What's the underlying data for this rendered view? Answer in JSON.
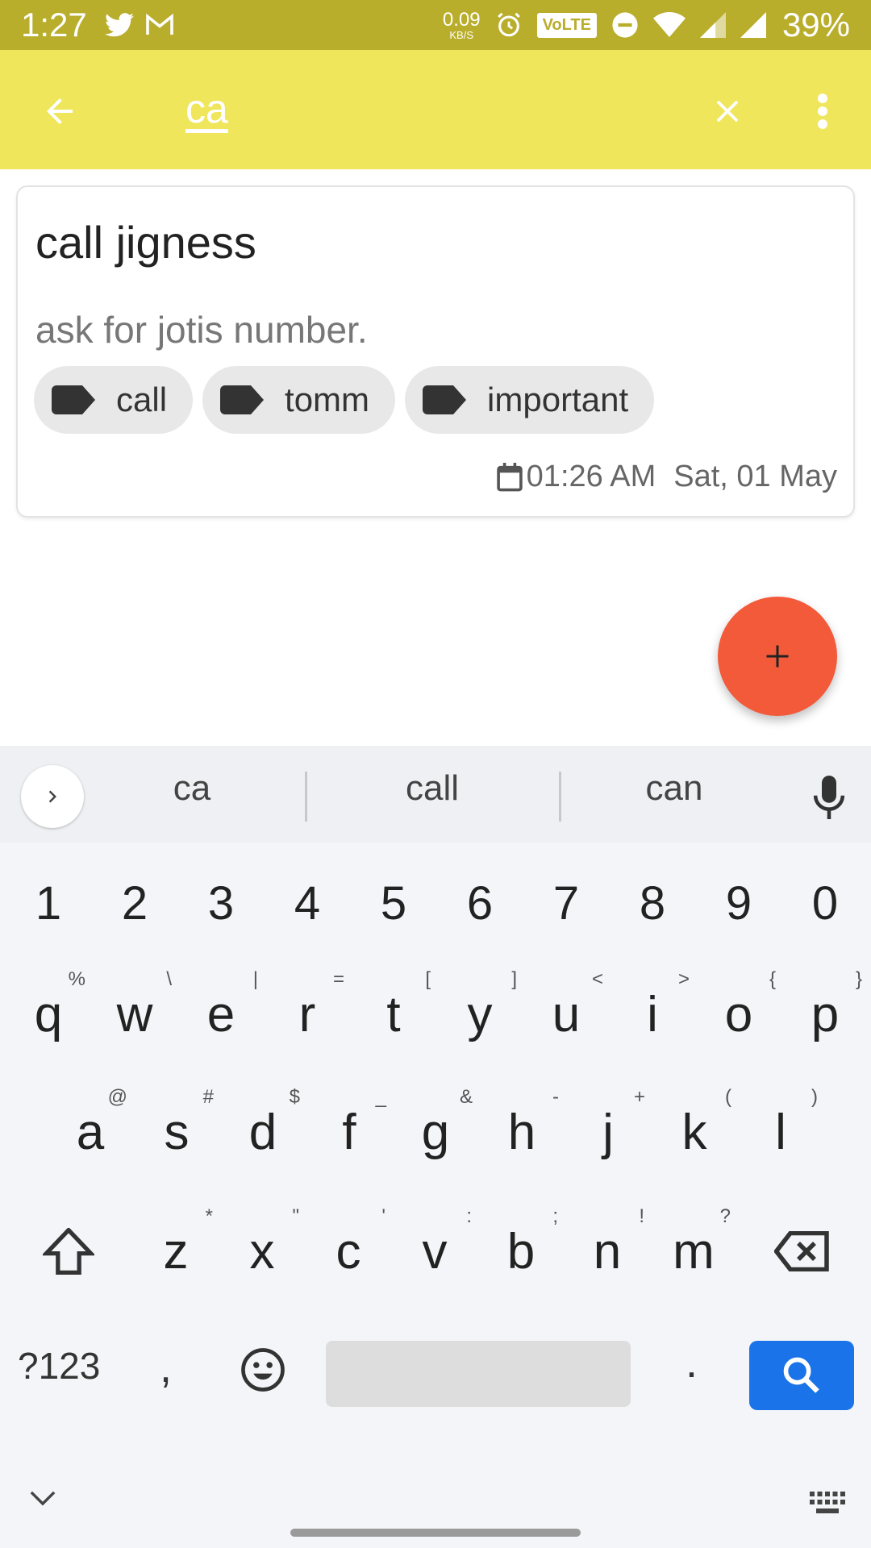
{
  "status_bar": {
    "time": "1:27",
    "net_speed": "0.09",
    "net_unit": "KB/S",
    "volte": "VoLTE",
    "battery": "39%",
    "icons": [
      "twitter-icon",
      "gmail-icon",
      "alarm-icon",
      "dnd-icon",
      "wifi-icon",
      "signal-icon",
      "signal-icon"
    ]
  },
  "app_bar": {
    "search_query": "ca",
    "color": "#efe65c"
  },
  "note": {
    "title": "call jigness",
    "body": "ask for jotis number.",
    "labels": [
      "call",
      "tomm",
      "important"
    ],
    "time": "01:26 AM",
    "date": "Sat, 01 May"
  },
  "fab": {
    "color": "#f25a3a",
    "icon": "plus-icon"
  },
  "keyboard": {
    "suggestions": [
      "ca",
      "call",
      "can"
    ],
    "number_row": [
      "1",
      "2",
      "3",
      "4",
      "5",
      "6",
      "7",
      "8",
      "9",
      "0"
    ],
    "row1": [
      {
        "k": "q",
        "h": "%"
      },
      {
        "k": "w",
        "h": "\\"
      },
      {
        "k": "e",
        "h": "|"
      },
      {
        "k": "r",
        "h": "="
      },
      {
        "k": "t",
        "h": "["
      },
      {
        "k": "y",
        "h": "]"
      },
      {
        "k": "u",
        "h": "<"
      },
      {
        "k": "i",
        "h": ">"
      },
      {
        "k": "o",
        "h": "{"
      },
      {
        "k": "p",
        "h": "}"
      }
    ],
    "row2": [
      {
        "k": "a",
        "h": "@"
      },
      {
        "k": "s",
        "h": "#"
      },
      {
        "k": "d",
        "h": "$"
      },
      {
        "k": "f",
        "h": "_"
      },
      {
        "k": "g",
        "h": "&"
      },
      {
        "k": "h",
        "h": "-"
      },
      {
        "k": "j",
        "h": "+"
      },
      {
        "k": "k",
        "h": "("
      },
      {
        "k": "l",
        "h": ")"
      }
    ],
    "row3": [
      {
        "k": "z",
        "h": "*"
      },
      {
        "k": "x",
        "h": "\""
      },
      {
        "k": "c",
        "h": "'"
      },
      {
        "k": "v",
        "h": ":"
      },
      {
        "k": "b",
        "h": ";"
      },
      {
        "k": "n",
        "h": "!"
      },
      {
        "k": "m",
        "h": "?"
      }
    ],
    "symbols_key": "?123",
    "comma_key": ",",
    "period_key": ".",
    "search_key_color": "#1a73e8"
  }
}
